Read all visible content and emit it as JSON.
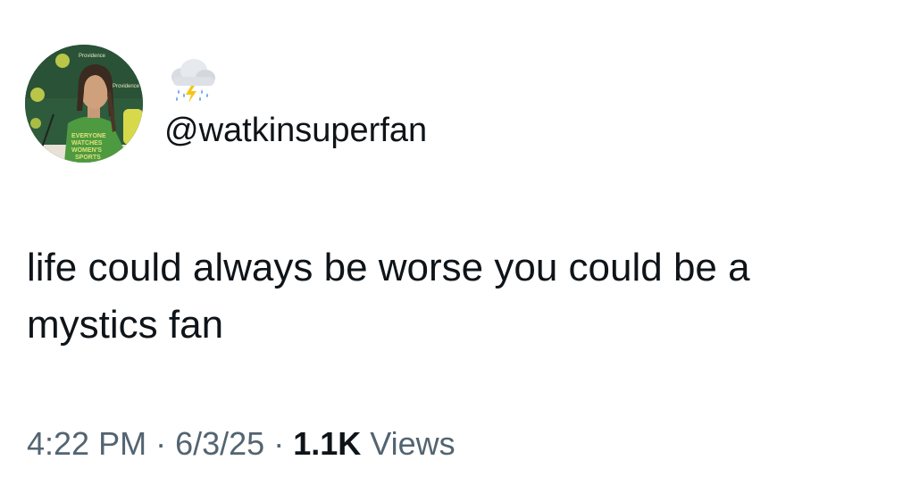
{
  "tweet": {
    "display_name_emoji": "cloud-with-lightning-and-rain-icon",
    "handle": "@watkinsuperfan",
    "text_line1": "life could always be worse you could be a",
    "text_line2": "mystics fan",
    "time": "4:22 PM",
    "separator": "·",
    "date": "6/3/25",
    "views_count": "1.1K",
    "views_label": "Views",
    "avatar_shirt_text": [
      "EVERYONE",
      "WATCHES",
      "WOMEN'S",
      "SPORTS"
    ],
    "avatar_backdrop_text": "Providence"
  },
  "colors": {
    "text_primary": "#0f1419",
    "text_secondary": "#536471",
    "background": "#ffffff"
  }
}
